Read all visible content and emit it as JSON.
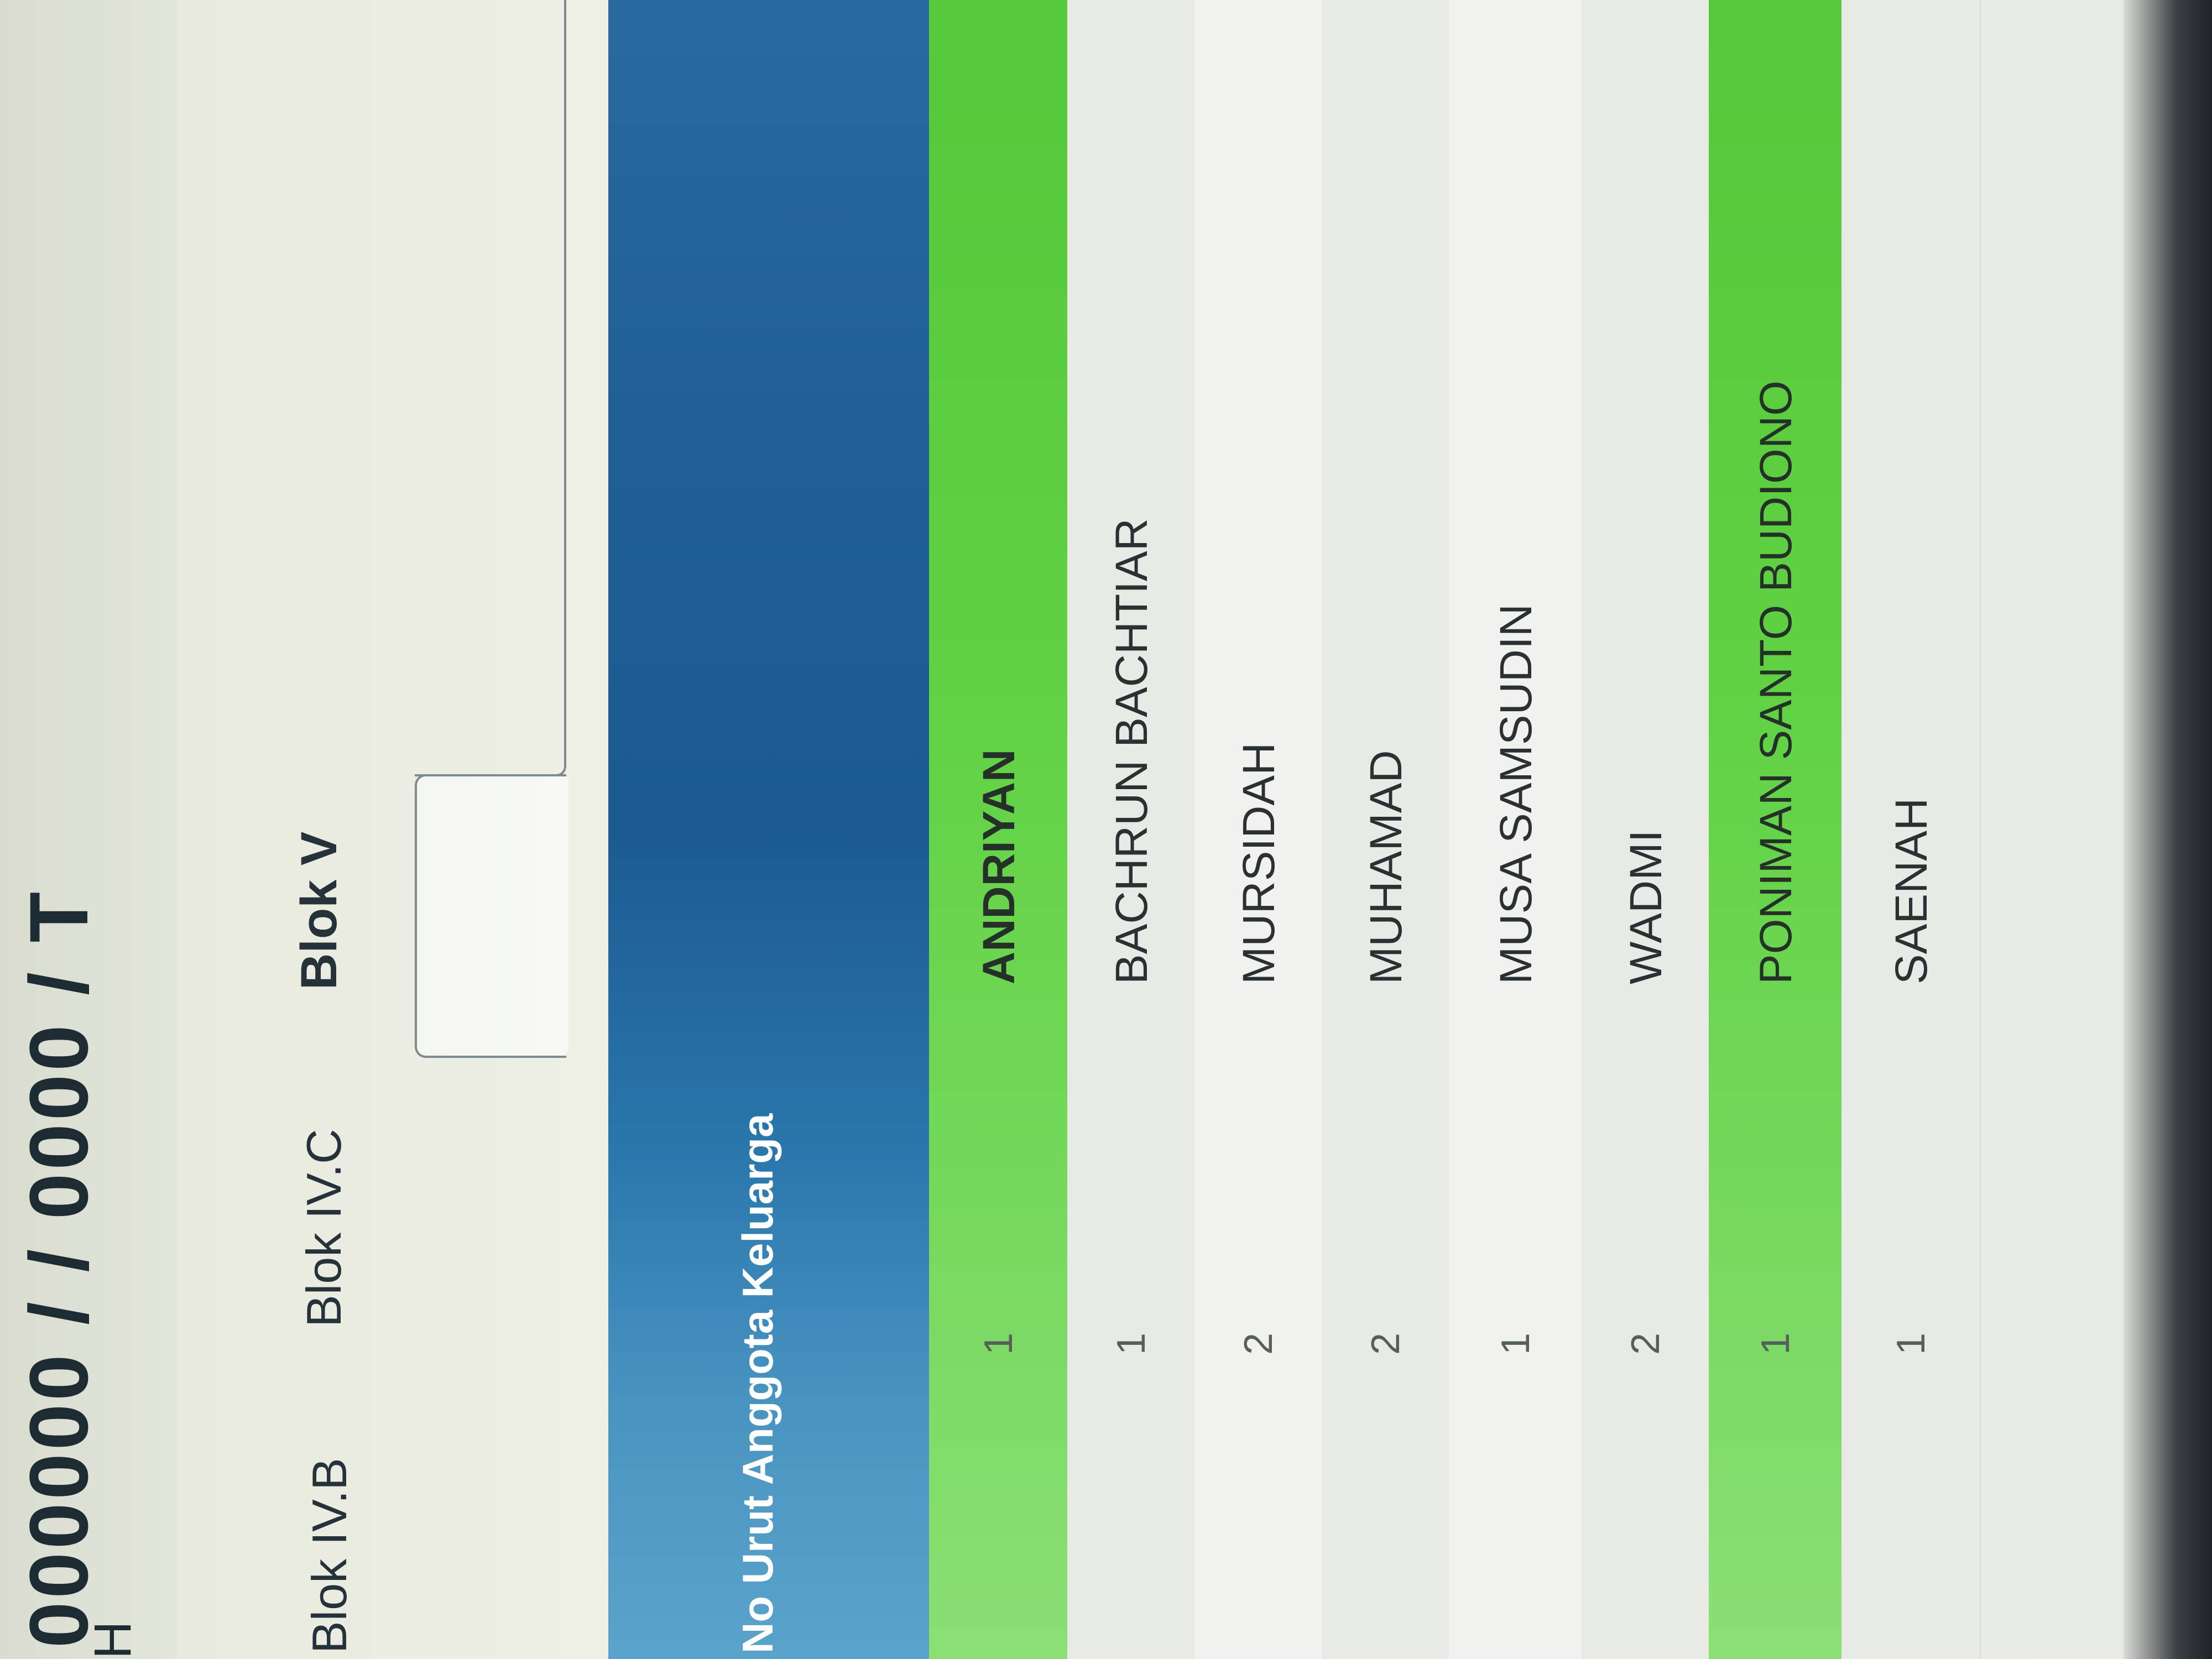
{
  "top": {
    "code": "000000 / / 0000 / T",
    "letter": "H"
  },
  "tabs": [
    {
      "label": "Blok IV.B",
      "active": false
    },
    {
      "label": "Blok IV.C",
      "active": false
    },
    {
      "label": "Blok V",
      "active": true
    }
  ],
  "table": {
    "header": "No Urut Anggota Keluarga",
    "rows": [
      {
        "no": "1",
        "name": "ANDRIYAN",
        "highlight": true
      },
      {
        "no": "1",
        "name": "BACHRUN BACHTIAR",
        "highlight": false
      },
      {
        "no": "2",
        "name": "MURSIDAH",
        "highlight": false
      },
      {
        "no": "2",
        "name": "MUHAMAD",
        "highlight": false
      },
      {
        "no": "1",
        "name": "MUSA SAMSUDIN",
        "highlight": false
      },
      {
        "no": "2",
        "name": "WADMI",
        "highlight": false
      },
      {
        "no": "1",
        "name": "PONIMAN SANTO BUDIONO",
        "highlight": true
      },
      {
        "no": "1",
        "name": "SAENAH",
        "highlight": false
      }
    ]
  },
  "colors": {
    "header_blue": "#1f5d94",
    "highlight_green": "#5fd142"
  }
}
